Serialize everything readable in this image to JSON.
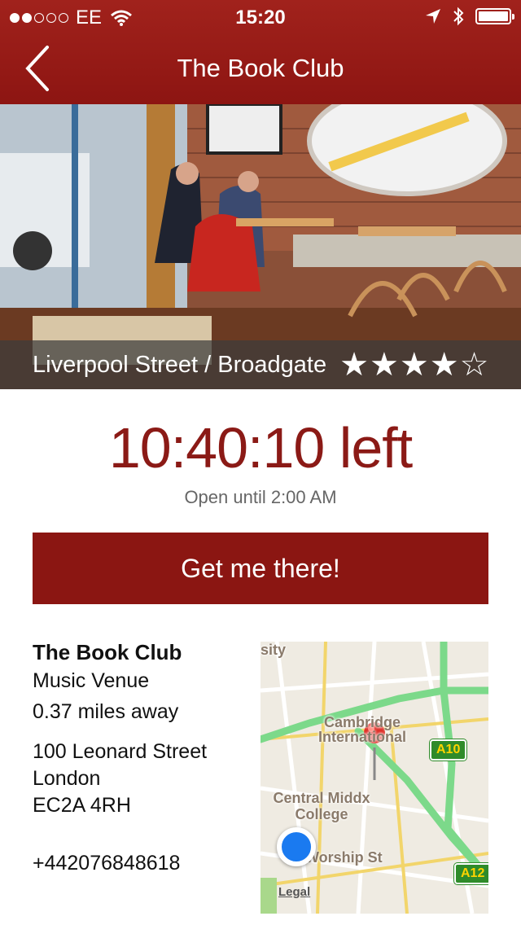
{
  "status_bar": {
    "carrier": "EE",
    "time": "15:20"
  },
  "nav": {
    "title": "The Book Club"
  },
  "hero": {
    "location": "Liverpool Street / Broadgate",
    "rating": 4,
    "rating_max": 5
  },
  "timer": {
    "countdown": "10:40:10 left",
    "open_until": "Open until 2:00 AM"
  },
  "cta": {
    "label": "Get me there!"
  },
  "venue": {
    "name": "The Book Club",
    "category": "Music Venue",
    "distance": "0.37 miles away",
    "address_line1": "100 Leonard Street",
    "address_line2": "London",
    "address_line3": "EC2A 4RH",
    "phone": "+442076848618"
  },
  "map": {
    "labels": {
      "sity": "sity",
      "cambridge": "Cambridge International",
      "central": "Central Middx College",
      "worship": "Worship St"
    },
    "badges": [
      "A10",
      "A12"
    ],
    "legal": "Legal"
  },
  "colors": {
    "brand": "#8b1612",
    "map_pin": "#e0302a",
    "user_location": "#1a7af0"
  }
}
